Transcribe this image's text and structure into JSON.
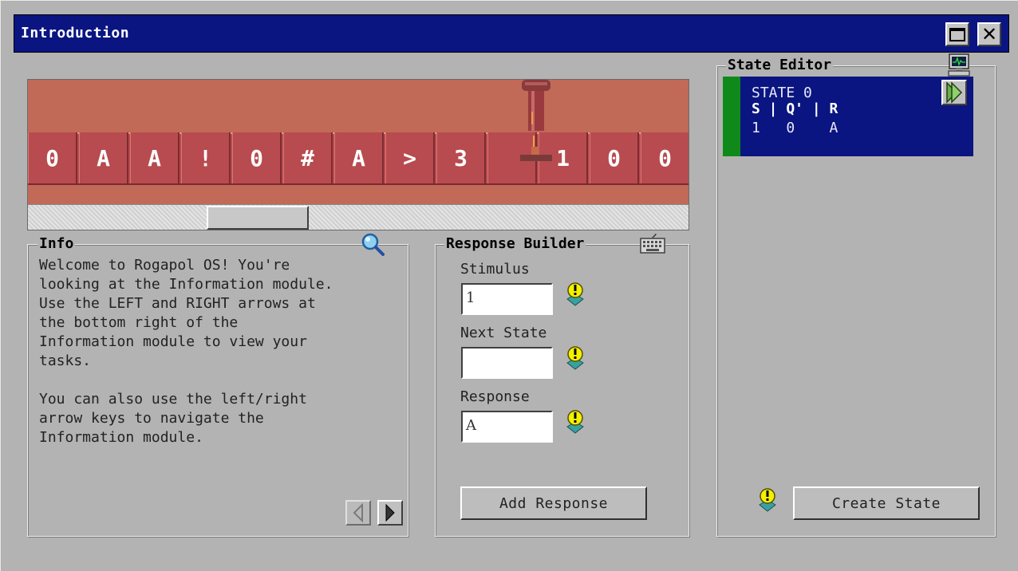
{
  "window": {
    "title": "Introduction"
  },
  "tape": {
    "cells": [
      "0",
      "A",
      "A",
      "!",
      "0",
      "#",
      "A",
      ">",
      "3",
      "",
      "1",
      "0",
      "0"
    ],
    "head_index": 9
  },
  "info": {
    "label": "Info",
    "icon": "magnifier-icon",
    "text": "Welcome to Rogapol OS! You're\nlooking at the Information module.\nUse the LEFT and RIGHT arrows at\nthe bottom right of the\nInformation module to view your\ntasks.\n\nYou can also use the left/right\narrow keys to navigate the\nInformation module."
  },
  "response_builder": {
    "label": "Response Builder",
    "icon": "keyboard-icon",
    "stimulus_label": "Stimulus",
    "stimulus_value": "1",
    "next_state_label": "Next State",
    "next_state_value": "",
    "response_label": "Response",
    "response_value": "A",
    "add_label": "Add Response"
  },
  "state_editor": {
    "label": "State Editor",
    "icon": "computer-monitor-icon",
    "card": {
      "title": "STATE 0",
      "header": "S | Q' | R",
      "row": "1   0    A"
    },
    "create_label": "Create State"
  },
  "colors": {
    "titlebar": "#0a1581",
    "tape_bg": "#c16a58",
    "tape_cell": "#b84b4f",
    "state_stripe": "#0f8a1a",
    "window_bg": "#b3b3b3"
  }
}
